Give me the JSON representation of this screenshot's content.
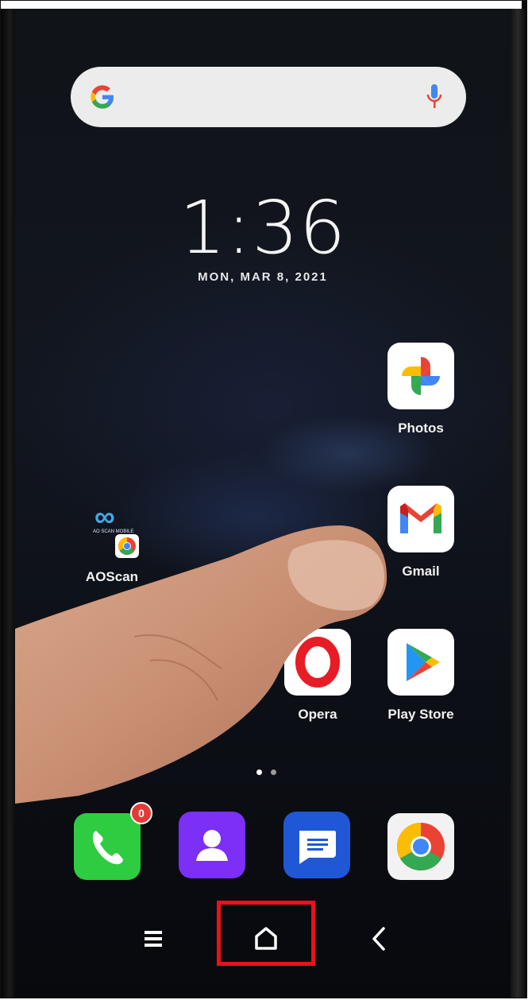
{
  "search": {
    "logo": "G",
    "mic_icon": "mic-icon"
  },
  "clock": {
    "time": "1:36",
    "date": "MON, MAR 8, 2021"
  },
  "apps": {
    "photos": "Photos",
    "gmail": "Gmail",
    "aoscan": "AOScan",
    "aoscan_caption": "AO SCAN MOBILE",
    "opera": "Opera",
    "playstore": "Play Store"
  },
  "dock": {
    "phone_badge": "0",
    "icons": [
      "phone-icon",
      "contacts-icon",
      "messages-icon",
      "chrome-icon"
    ]
  },
  "navbar": {
    "icons": [
      "menu-icon",
      "home-icon",
      "back-icon"
    ]
  },
  "colors": {
    "highlight": "#e8121a",
    "phone_green": "#2ecc40",
    "contacts_purple": "#7b2ff7",
    "messages_blue": "#1f57d6",
    "google_blue": "#4285F4",
    "google_red": "#EA4335",
    "google_yellow": "#FBBC05",
    "google_green": "#34A853"
  }
}
